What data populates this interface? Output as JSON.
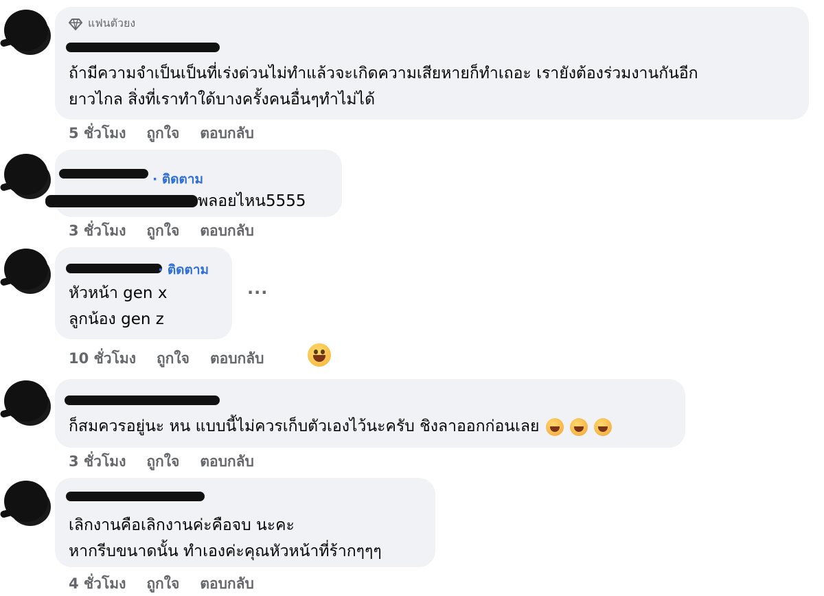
{
  "comments": [
    {
      "badge": "แฟนตัวยง",
      "lines": [
        "ถ้ามีความจำเป็นเป็นที่เร่งด่วนไม่ทำแล้วจะเกิดความเสียหายก็ทำเถอะ เรายังต้องร่วมงานกันอีก",
        "ยาวไกล สิ่งที่เราทำใด้บางครั้งคนอื่นๆทำไม่ได้"
      ],
      "time": "5 ชั่วโมง",
      "like": "ถูกใจ",
      "reply": "ตอบกลับ"
    },
    {
      "follow": "· ติดตาม",
      "lines": [
        "พลอยไหน5555"
      ],
      "time": "3 ชั่วโมง",
      "like": "ถูกใจ",
      "reply": "ตอบกลับ"
    },
    {
      "follow": "· ติดตาม",
      "lines": [
        "หัวหน้า gen x",
        "ลูกน้อง gen z"
      ],
      "more": "···",
      "time": "10 ชั่วโมง",
      "like": "ถูกใจ",
      "reply": "ตอบกลับ",
      "reaction": "grinning-face"
    },
    {
      "lines": [
        "ก็สมควรอยู่นะ หน แบบนี้ไม่ควรเก็บตัวเองไว้นะครับ ชิงลาออกก่อนเลย"
      ],
      "emoji": [
        "rolling-laughing-face",
        "rolling-laughing-face",
        "rolling-laughing-face"
      ],
      "time": "3 ชั่วโมง",
      "like": "ถูกใจ",
      "reply": "ตอบกลับ"
    },
    {
      "lines": [
        "เลิกงานคือเลิกงานค่ะคือจบ นะคะ",
        "หากรีบขนาดนั้น ทำเองค่ะคุณหัวหน้าที่ร้ากๆๆๆ"
      ],
      "time": "4 ชั่วโมง",
      "like": "ถูกใจ",
      "reply": "ตอบกลับ"
    }
  ],
  "colors": {
    "bubble": "#f0f2f5",
    "meta": "#65676b",
    "link": "#2f6fd6",
    "text": "#050505"
  }
}
